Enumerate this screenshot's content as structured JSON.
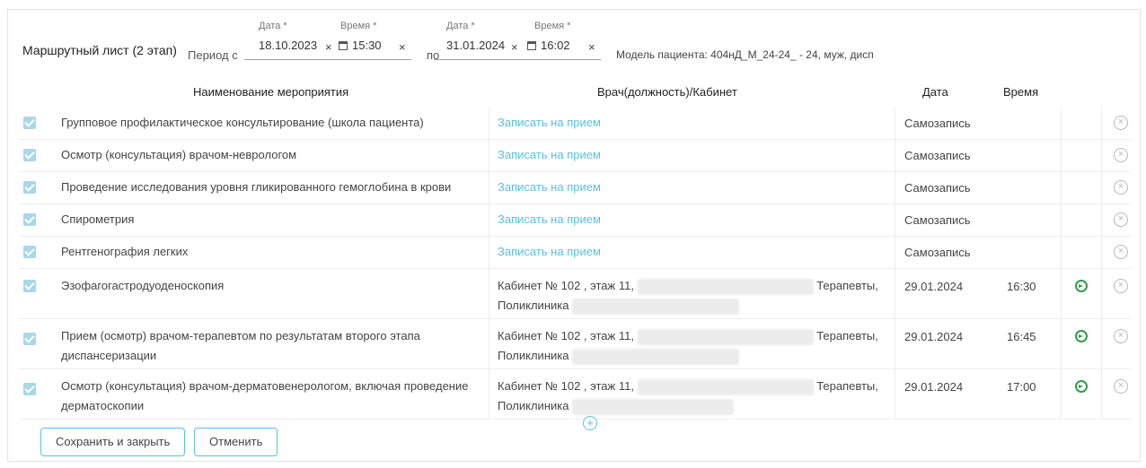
{
  "header": {
    "title": "Маршрутный лист (2 этап)",
    "period_from_label": "Период с",
    "period_to_label": "по",
    "from_date": {
      "caption": "Дата *",
      "value": "18.10.2023"
    },
    "from_time": {
      "caption": "Время *",
      "value": "15:30"
    },
    "to_date": {
      "caption": "Дата *",
      "value": "31.01.2024"
    },
    "to_time": {
      "caption": "Время *",
      "value": "16:02"
    },
    "clear_glyph": "×",
    "model": "Модель пациента: 404нД_М_24-24_ - 24, муж, дисп"
  },
  "table": {
    "columns": {
      "name": "Наименование мероприятия",
      "doctor": "Врач(должность)/Кабинет",
      "date": "Дата",
      "time": "Время"
    },
    "rows": [
      {
        "name": "Групповое профилактическое консультирование (школа пациента)",
        "doctor": "Записать на прием",
        "date": "Самозапись",
        "time": ""
      },
      {
        "name": "Осмотр (консультация) врачом-неврологом",
        "doctor": "Записать на прием",
        "date": "Самозапись",
        "time": ""
      },
      {
        "name": "Проведение исследования уровня гликированного гемоглобина в крови",
        "doctor": "Записать на прием",
        "date": "Самозапись",
        "time": ""
      },
      {
        "name": "Спирометрия",
        "doctor": "Записать на прием",
        "date": "Самозапись",
        "time": ""
      },
      {
        "name": "Рентгенография легких",
        "doctor": "Записать на прием",
        "date": "Самозапись",
        "time": ""
      },
      {
        "name": "Эзофагогастродуоденоскопия",
        "doctor_line1": "Кабинет № 102 , этаж 11,",
        "doctor_line1_end": "Терапевты,",
        "doctor_line2": "Поликлиника",
        "date": "29.01.2024",
        "time": "16:30"
      },
      {
        "name": "Прием (осмотр) врачом-терапевтом по результатам второго этапа диспансеризации",
        "doctor_line1": "Кабинет № 102 , этаж 11,",
        "doctor_line1_end": "Терапевты,",
        "doctor_line2": "Поликлиника",
        "date": "29.01.2024",
        "time": "16:45"
      },
      {
        "name": "Осмотр (консультация) врачом-дерматовенерологом, включая проведение дерматоскопии",
        "doctor_line1": "Кабинет № 102 , этаж 11,",
        "doctor_line1_end": "Терапевты,",
        "doctor_line2": "Поликлиника",
        "date": "29.01.2024",
        "time": "17:00"
      }
    ]
  },
  "add_glyph": "+",
  "remove_glyph": "×",
  "buttons": {
    "save": "Сохранить и закрыть",
    "cancel": "Отменить"
  },
  "colors": {
    "link": "#5bc0de",
    "self_record": "#e53935",
    "go": "#2e9d4e"
  },
  "icons": [
    "checkbox-icon",
    "calendar-icon",
    "clear-icon",
    "navigate-icon",
    "remove-icon",
    "add-icon"
  ]
}
